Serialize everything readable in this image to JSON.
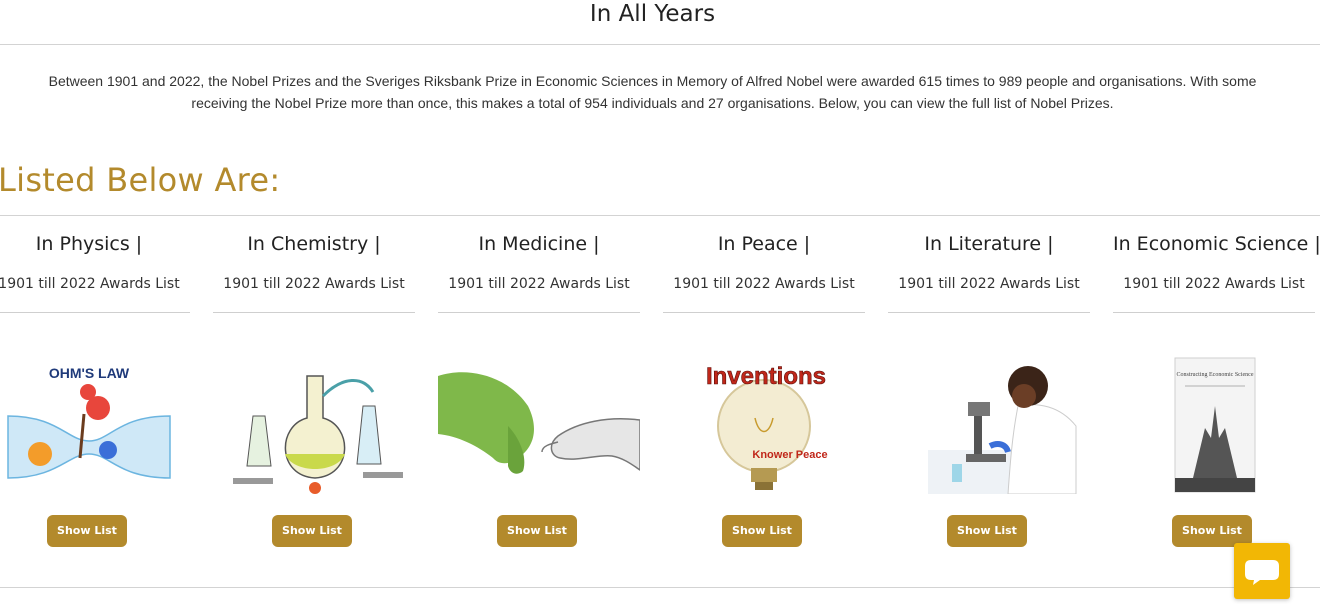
{
  "header": {
    "title": "In All Years"
  },
  "intro": {
    "line1": "Between 1901 and 2022, the Nobel Prizes and the Sveriges Riksbank Prize in Economic Sciences in Memory of Alfred Nobel were awarded 615 times to 989 people and organisations. With some",
    "line2": "receiving the Nobel Prize more than once, this makes a total of 954 individuals and 27 organisations. Below, you can view the full list of Nobel Prizes."
  },
  "section": {
    "heading": "Listed Below Are:"
  },
  "categories": [
    {
      "title": "In Physics |",
      "subtitle": "1901 till 2022 Awards List",
      "image_text": "OHM'S LAW",
      "button": "Show List"
    },
    {
      "title": "In Chemistry |",
      "subtitle": "1901 till 2022 Awards List",
      "button": "Show List"
    },
    {
      "title": "In Medicine |",
      "subtitle": "1901 till 2022 Awards List",
      "button": "Show List"
    },
    {
      "title": "In Peace |",
      "subtitle": "1901 till 2022 Awards List",
      "image_text": "Inventions",
      "image_text2": "Knower Peace",
      "button": "Show List"
    },
    {
      "title": "In Literature |",
      "subtitle": "1901 till 2022 Awards List",
      "button": "Show List"
    },
    {
      "title": "In Economic Science |",
      "subtitle": "1901 till 2022 Awards List",
      "image_text": "Constructing Economic Science",
      "button": "Show List"
    }
  ],
  "colors": {
    "accent": "#b38a2c",
    "chat": "#f2b705",
    "rule": "#d3d3d3"
  },
  "chat": {
    "icon": "chat-bubble-icon"
  }
}
